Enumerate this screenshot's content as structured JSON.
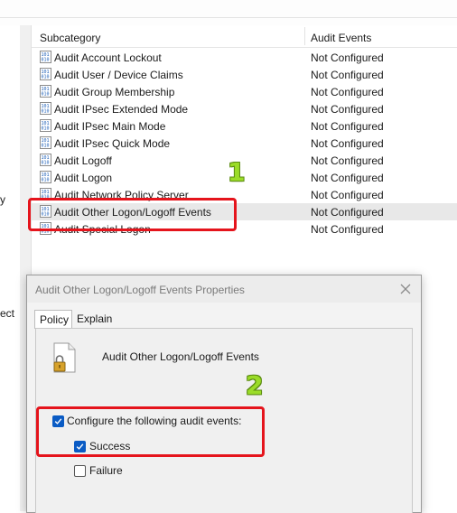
{
  "left_pane": {
    "fragment_1": "y",
    "fragment_2": "ect"
  },
  "list": {
    "header": {
      "subcategory": "Subcategory",
      "audit_events": "Audit Events"
    },
    "rows": [
      {
        "label": "Audit Account Lockout",
        "status": "Not Configured",
        "icon": "policy-icon"
      },
      {
        "label": "Audit User / Device Claims",
        "status": "Not Configured",
        "icon": "policy-icon"
      },
      {
        "label": "Audit Group Membership",
        "status": "Not Configured",
        "icon": "policy-icon"
      },
      {
        "label": "Audit IPsec Extended Mode",
        "status": "Not Configured",
        "icon": "policy-icon"
      },
      {
        "label": "Audit IPsec Main Mode",
        "status": "Not Configured",
        "icon": "policy-icon"
      },
      {
        "label": "Audit IPsec Quick Mode",
        "status": "Not Configured",
        "icon": "policy-icon"
      },
      {
        "label": "Audit Logoff",
        "status": "Not Configured",
        "icon": "policy-icon"
      },
      {
        "label": "Audit Logon",
        "status": "Not Configured",
        "icon": "policy-icon"
      },
      {
        "label": "Audit Network Policy Server",
        "status": "Not Configured",
        "icon": "policy-icon"
      },
      {
        "label": "Audit Other Logon/Logoff Events",
        "status": "Not Configured",
        "icon": "policy-icon",
        "selected": true
      },
      {
        "label": "Audit Special Logon",
        "status": "Not Configured",
        "icon": "policy-icon"
      }
    ]
  },
  "annotations": {
    "step1": "1",
    "step2": "2",
    "highlight_color": "#e5141c",
    "number_color": "#9bdc28"
  },
  "dialog": {
    "title": "Audit Other Logon/Logoff Events Properties",
    "close_icon": "close-icon",
    "tabs": [
      {
        "label": "Policy",
        "active": true
      },
      {
        "label": "Explain",
        "active": false
      }
    ],
    "policy_name": "Audit Other Logon/Logoff Events",
    "configure_label": "Configure the following audit events:",
    "configure_checked": true,
    "success_label": "Success",
    "success_checked": true,
    "failure_label": "Failure",
    "failure_checked": false,
    "accent_color": "#0a5bc4"
  }
}
